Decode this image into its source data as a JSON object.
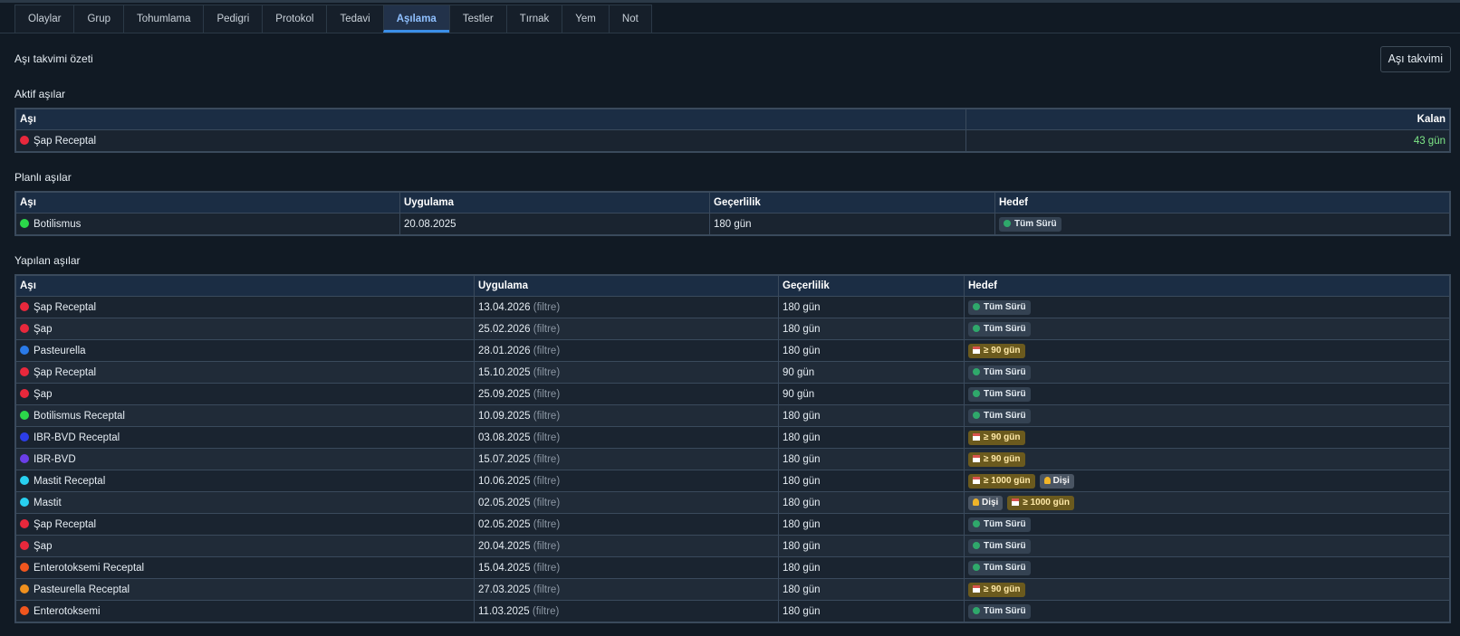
{
  "tabs": [
    "Olaylar",
    "Grup",
    "Tohumlama",
    "Pedigri",
    "Protokol",
    "Tedavi",
    "Aşılama",
    "Testler",
    "Tırnak",
    "Yem",
    "Not"
  ],
  "active_tab": "Aşılama",
  "summary": {
    "title": "Aşı takvimi özeti",
    "button": "Aşı takvimi"
  },
  "active": {
    "title": "Aktif aşılar",
    "headers": {
      "vaccine": "Aşı",
      "remaining": "Kalan"
    },
    "rows": [
      {
        "name": "Şap Receptal",
        "color": "#e8283c",
        "remaining": "43 gün"
      }
    ]
  },
  "planned": {
    "title": "Planlı aşılar",
    "headers": {
      "vaccine": "Aşı",
      "applied": "Uygulama",
      "validity": "Geçerlilik",
      "target": "Hedef"
    },
    "rows": [
      {
        "name": "Botilismus",
        "color": "#2bd94a",
        "date": "20.08.2025",
        "validity": "180 gün",
        "targets": [
          {
            "type": "herd",
            "icon": "globe-icon",
            "label": "Tüm Sürü"
          }
        ]
      }
    ]
  },
  "done": {
    "title": "Yapılan aşılar",
    "filter_label": "(filtre)",
    "headers": {
      "vaccine": "Aşı",
      "applied": "Uygulama",
      "validity": "Geçerlilik",
      "target": "Hedef"
    },
    "rows": [
      {
        "name": "Şap Receptal",
        "color": "#e8283c",
        "date": "13.04.2026",
        "validity": "180 gün",
        "targets": [
          {
            "type": "herd",
            "icon": "globe-icon",
            "label": "Tüm Sürü"
          }
        ]
      },
      {
        "name": "Şap",
        "color": "#e8283c",
        "date": "25.02.2026",
        "validity": "180 gün",
        "targets": [
          {
            "type": "herd",
            "icon": "globe-icon",
            "label": "Tüm Sürü"
          }
        ]
      },
      {
        "name": "Pasteurella",
        "color": "#2a7ae8",
        "date": "28.01.2026",
        "validity": "180 gün",
        "targets": [
          {
            "type": "days",
            "icon": "calendar-icon",
            "label": "≥ 90 gün"
          }
        ]
      },
      {
        "name": "Şap Receptal",
        "color": "#e8283c",
        "date": "15.10.2025",
        "validity": "90 gün",
        "targets": [
          {
            "type": "herd",
            "icon": "globe-icon",
            "label": "Tüm Sürü"
          }
        ]
      },
      {
        "name": "Şap",
        "color": "#e8283c",
        "date": "25.09.2025",
        "validity": "90 gün",
        "targets": [
          {
            "type": "herd",
            "icon": "globe-icon",
            "label": "Tüm Sürü"
          }
        ]
      },
      {
        "name": "Botilismus Receptal",
        "color": "#2bd94a",
        "date": "10.09.2025",
        "validity": "180 gün",
        "targets": [
          {
            "type": "herd",
            "icon": "globe-icon",
            "label": "Tüm Sürü"
          }
        ]
      },
      {
        "name": "IBR-BVD Receptal",
        "color": "#2c3ee8",
        "date": "03.08.2025",
        "validity": "180 gün",
        "targets": [
          {
            "type": "days",
            "icon": "calendar-icon",
            "label": "≥ 90 gün"
          }
        ]
      },
      {
        "name": "IBR-BVD",
        "color": "#6a3ee8",
        "date": "15.07.2025",
        "validity": "180 gün",
        "targets": [
          {
            "type": "days",
            "icon": "calendar-icon",
            "label": "≥ 90 gün"
          }
        ]
      },
      {
        "name": "Mastit Receptal",
        "color": "#28d0f0",
        "date": "10.06.2025",
        "validity": "180 gün",
        "targets": [
          {
            "type": "days",
            "icon": "calendar-icon",
            "label": "≥ 1000 gün"
          },
          {
            "type": "fem",
            "icon": "female-icon",
            "label": "Dişi"
          }
        ]
      },
      {
        "name": "Mastit",
        "color": "#28d0f0",
        "date": "02.05.2025",
        "validity": "180 gün",
        "targets": [
          {
            "type": "fem",
            "icon": "female-icon",
            "label": "Dişi"
          },
          {
            "type": "days",
            "icon": "calendar-icon",
            "label": "≥ 1000 gün"
          }
        ]
      },
      {
        "name": "Şap Receptal",
        "color": "#e8283c",
        "date": "02.05.2025",
        "validity": "180 gün",
        "targets": [
          {
            "type": "herd",
            "icon": "globe-icon",
            "label": "Tüm Sürü"
          }
        ]
      },
      {
        "name": "Şap",
        "color": "#e8283c",
        "date": "20.04.2025",
        "validity": "180 gün",
        "targets": [
          {
            "type": "herd",
            "icon": "globe-icon",
            "label": "Tüm Sürü"
          }
        ]
      },
      {
        "name": "Enterotoksemi Receptal",
        "color": "#f0561e",
        "date": "15.04.2025",
        "validity": "180 gün",
        "targets": [
          {
            "type": "herd",
            "icon": "globe-icon",
            "label": "Tüm Sürü"
          }
        ]
      },
      {
        "name": "Pasteurella Receptal",
        "color": "#f0901e",
        "date": "27.03.2025",
        "validity": "180 gün",
        "targets": [
          {
            "type": "days",
            "icon": "calendar-icon",
            "label": "≥ 90 gün"
          }
        ]
      },
      {
        "name": "Enterotoksemi",
        "color": "#f0561e",
        "date": "11.03.2025",
        "validity": "180 gün",
        "targets": [
          {
            "type": "herd",
            "icon": "globe-icon",
            "label": "Tüm Sürü"
          }
        ]
      }
    ]
  }
}
